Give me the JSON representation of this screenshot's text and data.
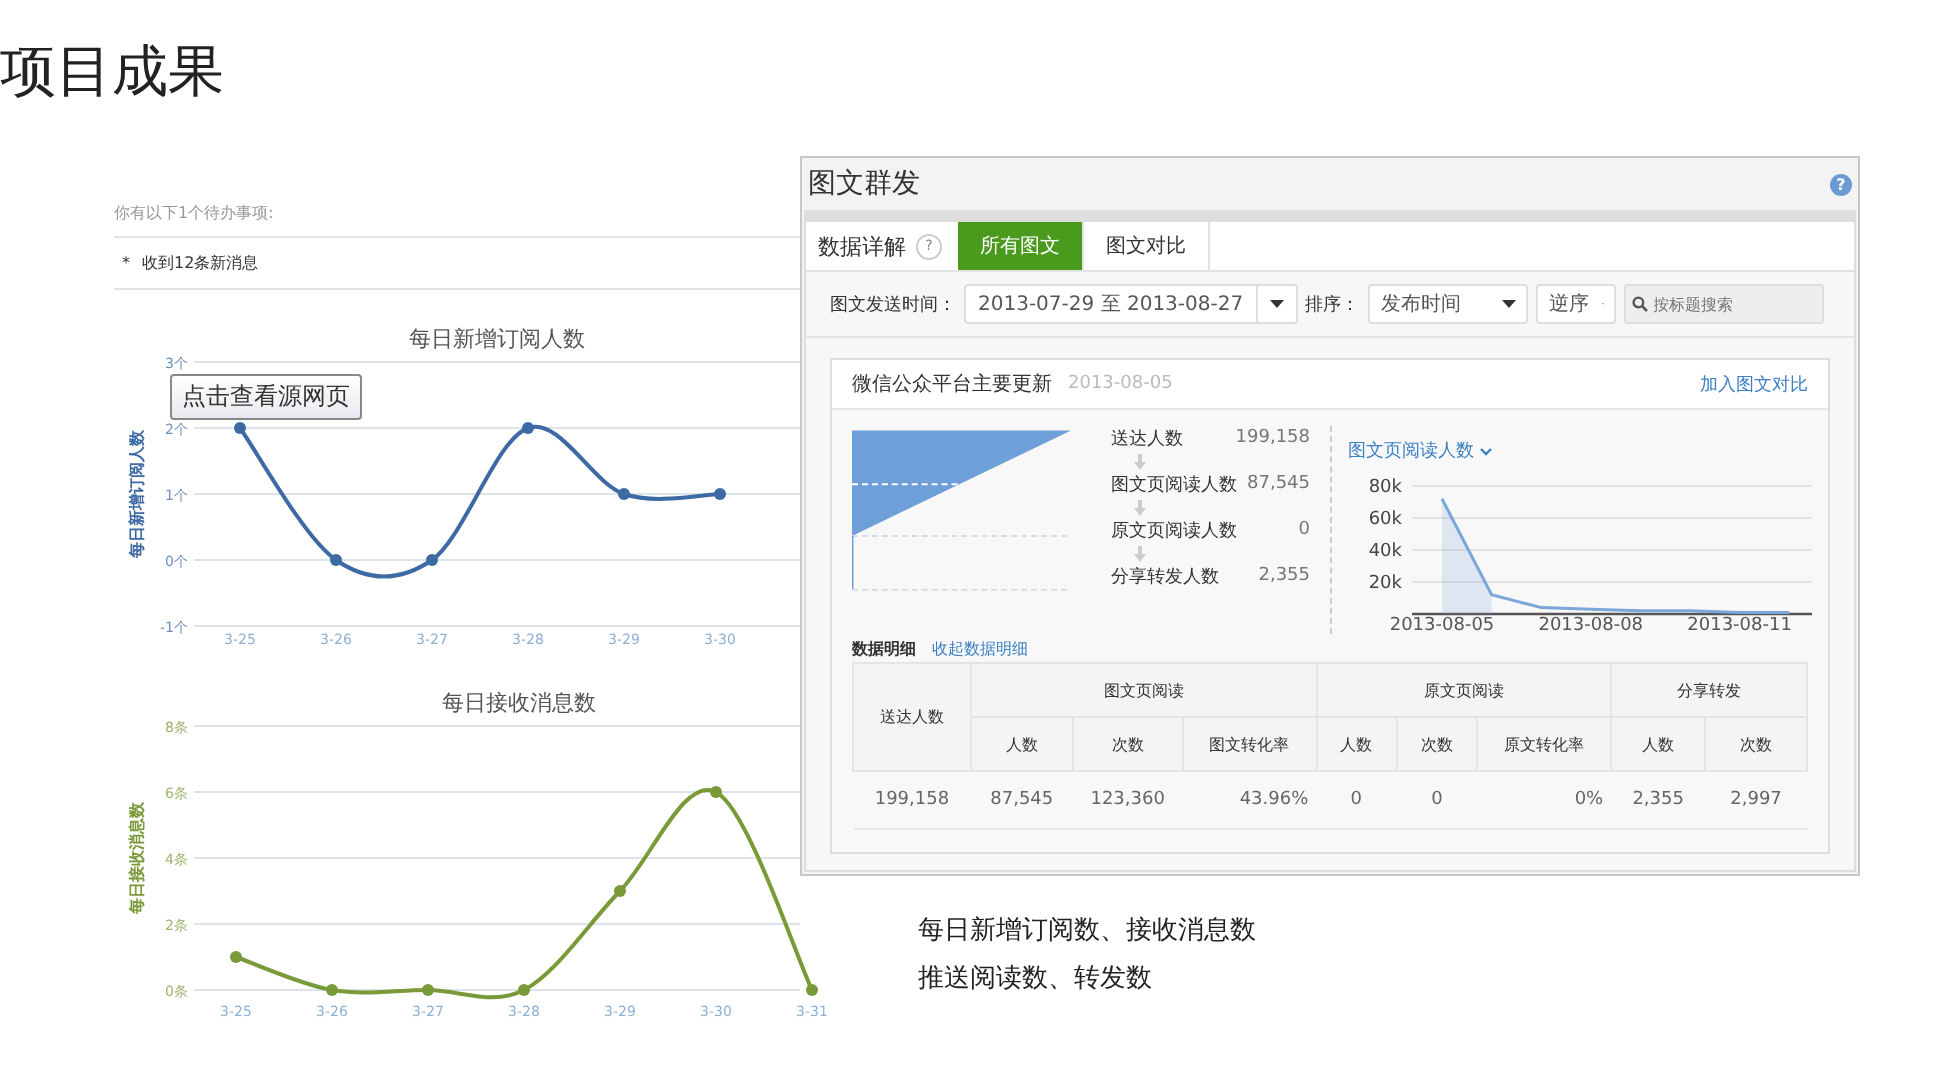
{
  "page_title": "项目成果",
  "dashboard": {
    "todo_header": "你有以下1个待办事项:",
    "todo_items": [
      {
        "marker": "*",
        "text": "收到12条新消息"
      }
    ],
    "tooltip": "点击查看源网页",
    "charts": [
      {
        "chart_data": {
          "type": "line",
          "title": "每日新增订阅人数",
          "ylabel": "每日新增订阅人数",
          "categories": [
            "3-25",
            "3-26",
            "3-27",
            "3-28",
            "3-29",
            "3-30"
          ],
          "series": [
            {
              "color": "#3d6aa5",
              "marker": "circle",
              "values": [
                2,
                0,
                0,
                2,
                1,
                1
              ]
            }
          ],
          "grid": true,
          "ylim": [
            -1,
            3
          ],
          "yticks": [
            {
              "value": -1,
              "label": "-1个"
            },
            {
              "value": 0,
              "label": "0个"
            },
            {
              "value": 1,
              "label": "1个"
            },
            {
              "value": 2,
              "label": "2个"
            },
            {
              "value": 3,
              "label": "3个"
            }
          ]
        }
      },
      {
        "chart_data": {
          "type": "line",
          "title": "每日接收消息数",
          "ylabel": "每日接收消息数",
          "categories": [
            "3-25",
            "3-26",
            "3-27",
            "3-28",
            "3-29",
            "3-30",
            "3-31"
          ],
          "series": [
            {
              "color": "#7a9a3a",
              "marker": "circle",
              "values": [
                1,
                0,
                0,
                0,
                3,
                6,
                0
              ]
            }
          ],
          "grid": true,
          "ylim": [
            0,
            8
          ],
          "yticks": [
            {
              "value": 0,
              "label": "0条"
            },
            {
              "value": 2,
              "label": "2条"
            },
            {
              "value": 4,
              "label": "4条"
            },
            {
              "value": 6,
              "label": "6条"
            },
            {
              "value": 8,
              "label": "8条"
            }
          ]
        }
      }
    ]
  },
  "window": {
    "title": "图文群发",
    "help": "?",
    "tabs_label": "数据详解",
    "tabs": [
      {
        "label": "所有图文",
        "selected": true
      },
      {
        "label": "图文对比",
        "selected": false
      }
    ],
    "filters": {
      "date_label": "图文发送时间：",
      "date_range": "2013-07-29 至 2013-08-27",
      "sort_label": "排序：",
      "sort_field": "发布时间",
      "sort_order": "逆序",
      "search": {
        "placeholder": "按标题搜索"
      }
    },
    "card": {
      "title": "微信公众平台主要更新",
      "date": "2013-08-05",
      "link": "加入图文对比",
      "funnel": [
        {
          "label": "送达人数",
          "value": "199,158"
        },
        {
          "label": "图文页阅读人数",
          "value": "87,545"
        },
        {
          "label": "原文页阅读人数",
          "value": "0"
        },
        {
          "label": "分享转发人数",
          "value": "2,355"
        }
      ],
      "metric_selector": "图文页阅读人数",
      "chart_data": {
        "type": "line",
        "categories": [
          "2013-08-05",
          null,
          null,
          "2013-08-08",
          null,
          null,
          "2013-08-11",
          null
        ],
        "series": [
          {
            "color": "#7aa7d8",
            "values": [
              72000,
              12000,
              4000,
              3000,
              2000,
              2000,
              1000,
              1000
            ]
          }
        ],
        "grid": true,
        "ylim": [
          0,
          80000
        ],
        "yticks": [
          {
            "value": 20000,
            "label": "20k"
          },
          {
            "value": 40000,
            "label": "40k"
          },
          {
            "value": 60000,
            "label": "60k"
          },
          {
            "value": 80000,
            "label": "80k"
          }
        ]
      },
      "details_label": "数据明细",
      "details_link": "收起数据明细",
      "table": {
        "first_column": "送达人数",
        "header_groups": [
          {
            "label": "图文页阅读",
            "columns": [
              "人数",
              "次数",
              "图文转化率"
            ]
          },
          {
            "label": "原文页阅读",
            "columns": [
              "人数",
              "次数",
              "原文转化率"
            ]
          },
          {
            "label": "分享转发",
            "columns": [
              "人数",
              "次数"
            ]
          }
        ],
        "rows": [
          [
            "199,158",
            "87,545",
            "123,360",
            "43.96%",
            "0",
            "0",
            "0%",
            "2,355",
            "2,997"
          ]
        ]
      }
    }
  },
  "caption": [
    "每日新增订阅数、接收消息数",
    "推送阅读数、转发数"
  ]
}
